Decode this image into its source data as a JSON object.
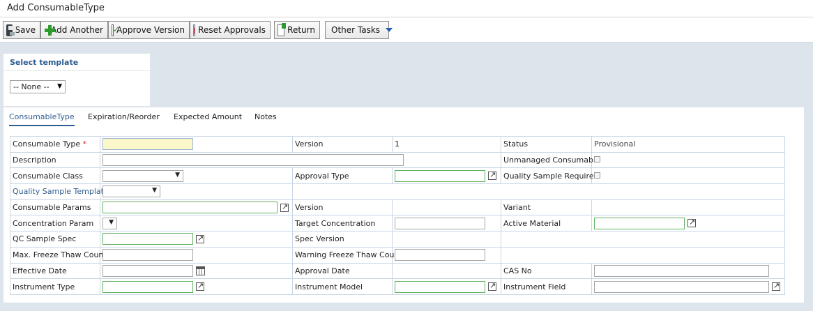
{
  "window": {
    "title": "Add ConsumableType"
  },
  "toolbar": {
    "buttons": [
      {
        "label": "Save",
        "icon": "save-icon"
      },
      {
        "label": "Add Another",
        "icon": "plus-icon"
      },
      {
        "label": "Approve Version",
        "icon": "approve-icon"
      },
      {
        "label": "Reset Approvals",
        "icon": "reset-icon"
      },
      {
        "label": "Return",
        "icon": "return-icon"
      },
      {
        "label": "Other Tasks",
        "icon": "caret-down-icon"
      }
    ]
  },
  "template": {
    "header": "Select template",
    "selected": "-- None --"
  },
  "tabs": [
    "ConsumableType",
    "Expiration/Reorder",
    "Expected Amount",
    "Notes"
  ],
  "form": {
    "consumable_type": "Consumable Type",
    "required_mark": "*",
    "version": "Version",
    "version_value": "1",
    "status": "Status",
    "status_value": "Provisional",
    "description": "Description",
    "unmanaged_consumable": "Unmanaged Consumable",
    "consumable_class": "Consumable Class",
    "approval_type": "Approval Type",
    "quality_sample_required": "Quality Sample Required",
    "quality_sample_template": "Quality Sample Template",
    "consumable_params": "Consumable Params",
    "params_version": "Version",
    "variant": "Variant",
    "concentration_param": "Concentration Param",
    "target_concentration": "Target Concentration",
    "active_material": "Active Material",
    "qc_sample_spec": "QC Sample Spec",
    "spec_version": "Spec Version",
    "max_freeze_thaw": "Max. Freeze Thaw Count",
    "warning_freeze_thaw": "Warning Freeze Thaw Count",
    "effective_date": "Effective Date",
    "approval_date": "Approval Date",
    "cas_no": "CAS No",
    "instrument_type": "Instrument Type",
    "instrument_model": "Instrument Model",
    "instrument_field": "Instrument Field"
  },
  "colors": {
    "accent": "#2f5d91",
    "required": "#dd2222",
    "lookup_border": "#5fb15f",
    "required_field_bg": "#fbf7c9"
  }
}
